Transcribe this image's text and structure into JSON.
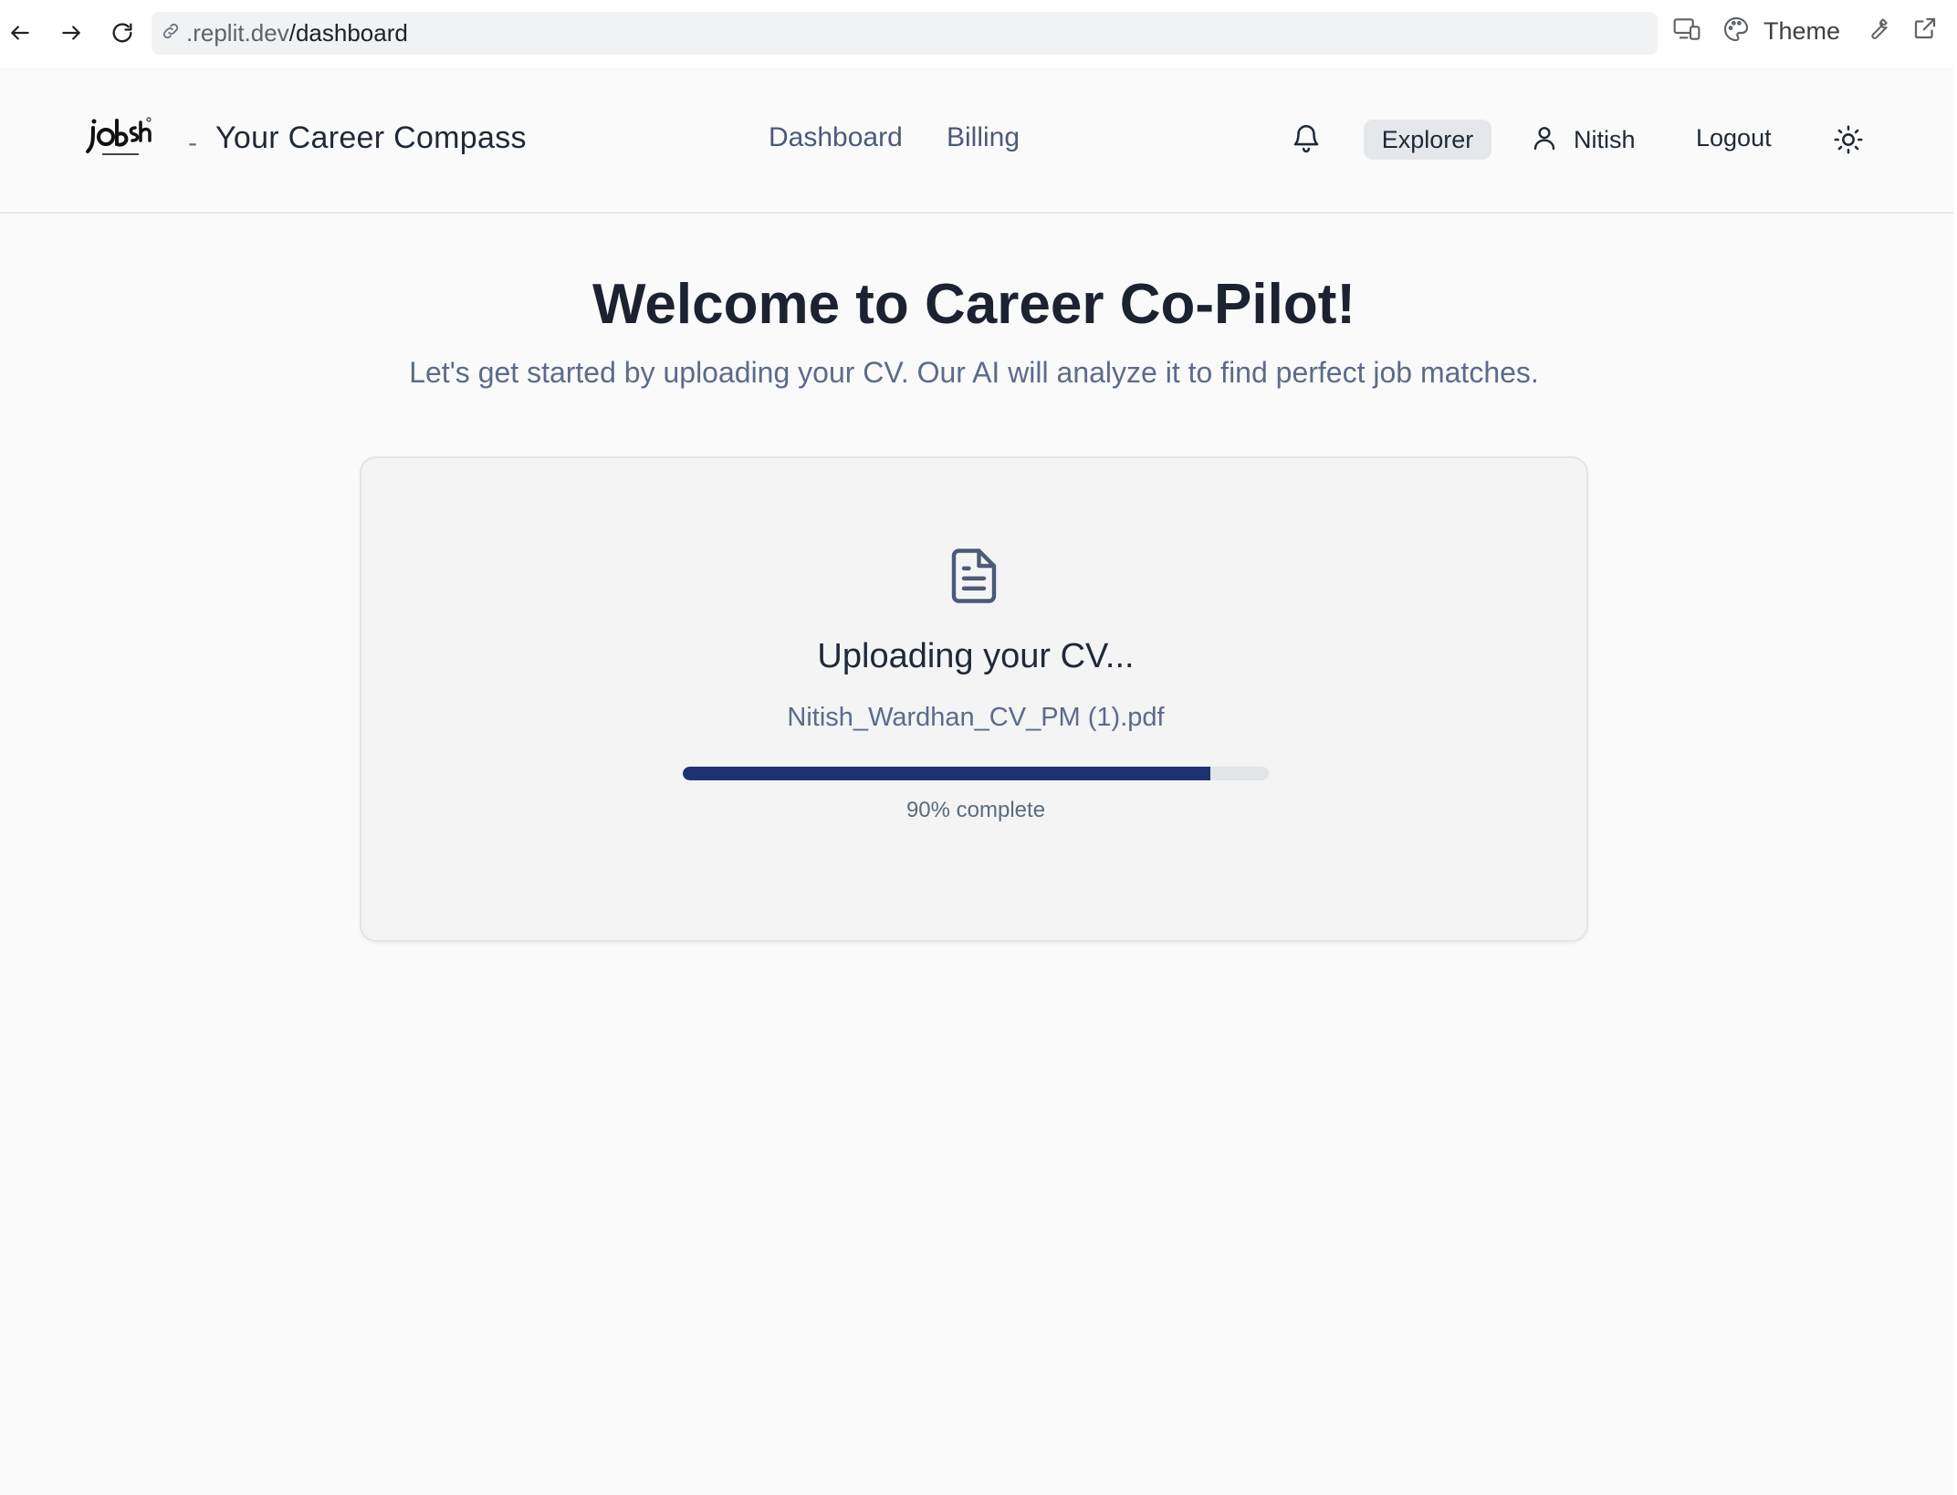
{
  "browser": {
    "url_host": ".replit.dev",
    "url_path": "/dashboard",
    "theme_label": "Theme",
    "icons": [
      "back-arrow-icon",
      "forward-arrow-icon",
      "reload-icon",
      "link-icon",
      "devices-icon",
      "palette-icon",
      "wrench-icon",
      "external-link-icon"
    ]
  },
  "header": {
    "brand_separator": "-",
    "brand_name": "Your Career Compass",
    "nav": [
      {
        "label": "Dashboard"
      },
      {
        "label": "Billing"
      }
    ],
    "plan_badge": "Explorer",
    "user_name": "Nitish",
    "logout_label": "Logout",
    "icons": [
      "bell-icon",
      "user-icon",
      "sun-icon"
    ]
  },
  "main": {
    "title": "Welcome to Career Co-Pilot!",
    "subtitle": "Let's get started by uploading your CV. Our AI will analyze it to find perfect job matches.",
    "upload": {
      "status": "Uploading your CV...",
      "file_name": "Nitish_Wardhan_CV_PM (1).pdf",
      "progress_percent": 90,
      "progress_label": "90% complete",
      "icon": "document-icon"
    }
  },
  "colors": {
    "accent": "#1e3273",
    "muted_text": "#5b6b8a",
    "heading": "#1c2230"
  }
}
